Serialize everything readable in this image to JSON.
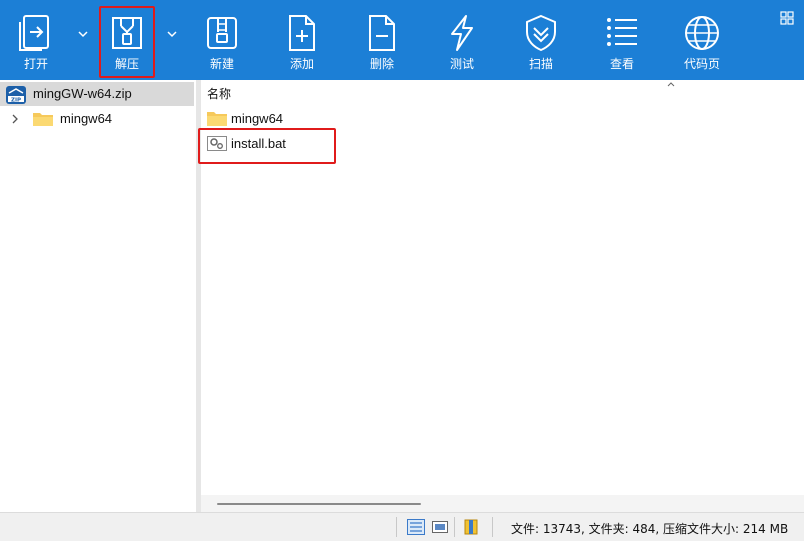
{
  "toolbar": {
    "buttons": [
      {
        "id": "open",
        "label": "打开",
        "icon": "open-icon"
      },
      {
        "id": "extract",
        "label": "解压",
        "icon": "extract-zip-icon"
      },
      {
        "id": "new",
        "label": "新建",
        "icon": "new-archive-icon"
      },
      {
        "id": "add",
        "label": "添加",
        "icon": "add-file-icon"
      },
      {
        "id": "delete",
        "label": "删除",
        "icon": "delete-file-icon"
      },
      {
        "id": "test",
        "label": "测试",
        "icon": "lightning-icon"
      },
      {
        "id": "scan",
        "label": "扫描",
        "icon": "shield-icon"
      },
      {
        "id": "view",
        "label": "查看",
        "icon": "list-icon"
      },
      {
        "id": "codepage",
        "label": "代码页",
        "icon": "globe-icon"
      }
    ],
    "background": "#1c7fd6",
    "highlight_color": "#e01b1b"
  },
  "tree": {
    "root_label": "mingGW-w64.zip",
    "child_label": "mingw64"
  },
  "list": {
    "column_name": "名称",
    "items": [
      {
        "name": "mingw64",
        "type": "folder",
        "icon": "folder-icon"
      },
      {
        "name": "install.bat",
        "type": "batch",
        "icon": "bat-file-icon"
      }
    ]
  },
  "status": {
    "text": "文件: 13743, 文件夹: 484, 压缩文件大小: 214 MB"
  }
}
